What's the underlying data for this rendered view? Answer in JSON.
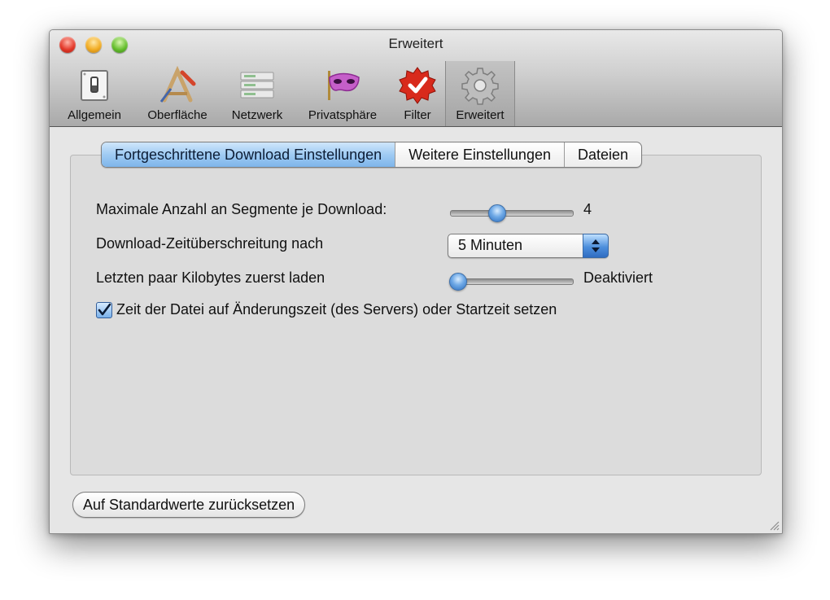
{
  "window": {
    "title": "Erweitert"
  },
  "toolbar": {
    "items": [
      {
        "label": "Allgemein",
        "icon": "switch-icon"
      },
      {
        "label": "Oberfläche",
        "icon": "drawing-tools-icon"
      },
      {
        "label": "Netzwerk",
        "icon": "server-rack-icon"
      },
      {
        "label": "Privatsphäre",
        "icon": "mask-icon"
      },
      {
        "label": "Filter",
        "icon": "checkmark-badge-icon"
      },
      {
        "label": "Erweitert",
        "icon": "gear-icon"
      }
    ],
    "selected": "Erweitert"
  },
  "tabs": {
    "items": [
      "Fortgeschrittene Download Einstellungen",
      "Weitere Einstellungen",
      "Dateien"
    ],
    "active": "Fortgeschrittene Download Einstellungen"
  },
  "settings": {
    "segments": {
      "label": "Maximale Anzahl an Segmente je Download:",
      "value": "4",
      "slider_fraction": 0.37
    },
    "timeout": {
      "label": "Download-Zeitüberschreitung nach",
      "value": "5 Minuten"
    },
    "last_kb": {
      "label": "Letzten paar Kilobytes zuerst laden",
      "value": "Deaktiviert",
      "slider_fraction": 0.0
    },
    "file_time": {
      "label": "Zeit der Datei auf Änderungszeit (des Servers) oder Startzeit setzen",
      "checked": true
    }
  },
  "reset_button": {
    "label": "Auf Standardwerte zurücksetzen"
  },
  "colors": {
    "accent": "#6fa9e6",
    "tab_active": "#9fcbf3"
  }
}
